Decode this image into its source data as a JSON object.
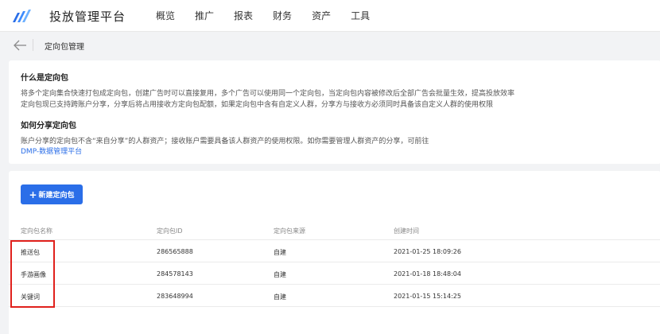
{
  "app": {
    "title": "投放管理平台"
  },
  "nav": {
    "items": [
      "概览",
      "推广",
      "报表",
      "财务",
      "资产",
      "工具"
    ]
  },
  "breadcrumb": {
    "page_title": "定向包管理"
  },
  "info": {
    "section1_title": "什么是定向包",
    "section1_line1": "将多个定向集合快速打包成定向包，创建广告时可以直接复用，多个广告可以使用同一个定向包，当定向包内容被修改后全部广告会批量生效，提高投放效率",
    "section1_line2": "定向包现已支持跨账户分享，分享后将占用接收方定向包配额，如果定向包中含有自定义人群，分享方与接收方必须同时具备该自定义人群的使用权限",
    "section2_title": "如何分享定向包",
    "section2_line1": "账户分享的定向包不含“来自分享”的人群资产；接收账户需要具备该人群资产的使用权限。如你需要管理人群资产的分享，可前往",
    "section2_link": "DMP-数据管理平台"
  },
  "toolbar": {
    "new_label": "新建定向包"
  },
  "table": {
    "headers": [
      "定向包名称",
      "定向包ID",
      "定向包来源",
      "创建时间"
    ],
    "rows": [
      [
        "推送包",
        "286565888",
        "自建",
        "2021-01-25 18:09:26"
      ],
      [
        "手游画像",
        "284578143",
        "自建",
        "2021-01-18 18:48:04"
      ],
      [
        "关键词",
        "283648994",
        "自建",
        "2021-01-15 15:14:25"
      ]
    ]
  },
  "colors": {
    "accent": "#2a6ee8",
    "highlight": "#e0211c"
  }
}
